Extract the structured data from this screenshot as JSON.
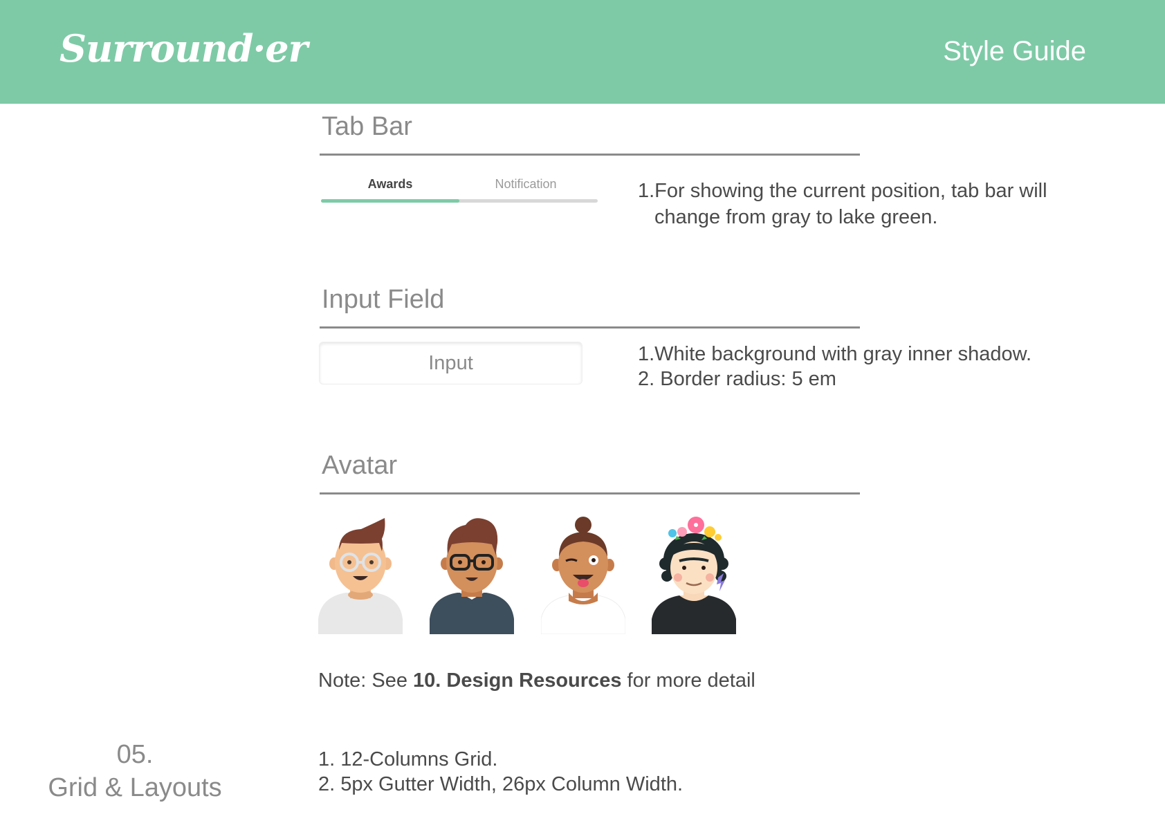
{
  "header": {
    "logo": "Surround·er",
    "title": "Style Guide",
    "bg_color": "#7ecaa7"
  },
  "tab_bar_section": {
    "title": "Tab Bar",
    "tabs": [
      {
        "label": "Awards",
        "active": true
      },
      {
        "label": "Notification",
        "active": false
      }
    ],
    "progress": 0.5,
    "active_color": "#7ecaa7",
    "inactive_color": "#d8d8d8",
    "desc_line1": "1.For showing the current position,  tab bar will",
    "desc_line2": "change from gray to lake green."
  },
  "input_section": {
    "title": "Input Field",
    "placeholder": "Input",
    "desc_line1": "1.White background with gray inner shadow.",
    "desc_line2": "2. Border radius: 5 em"
  },
  "avatar_section": {
    "title": "Avatar",
    "avatars": [
      {
        "icon": "man-glasses-avatar-icon"
      },
      {
        "icon": "man-dark-glasses-avatar-icon"
      },
      {
        "icon": "woman-winking-avatar-icon"
      },
      {
        "icon": "woman-flower-crown-avatar-icon"
      }
    ]
  },
  "note": {
    "prefix": "Note: See ",
    "bold": "10. Design Resources",
    "suffix": " for more detail"
  },
  "grid_section": {
    "number": "05.",
    "title": "Grid & Layouts",
    "line1": "1. 12-Columns Grid.",
    "line2": "2. 5px Gutter Width, 26px Column Width."
  }
}
